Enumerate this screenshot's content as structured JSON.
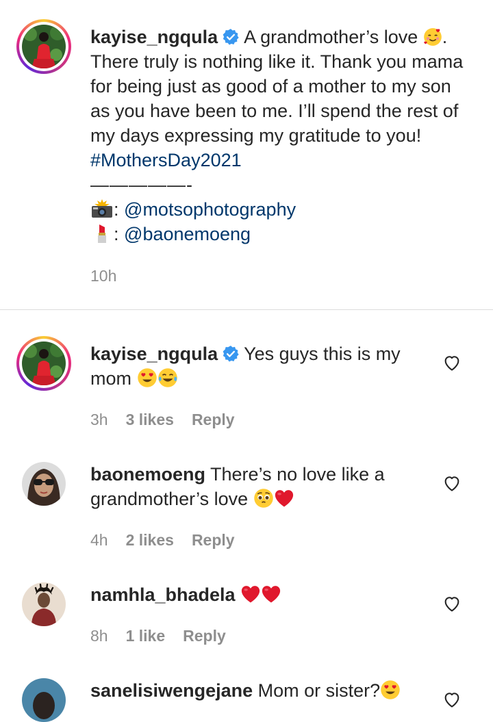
{
  "caption": {
    "username": "kayise_ngqula",
    "line1_text": "A grandmother’s love",
    "line1_end": ".",
    "body": "There truly is nothing like it. Thank you mama for being just as good of a mother to my son as you have been to me. I’ll spend the rest of my days expressing my gratitude to you!",
    "hashtag": "#MothersDay2021",
    "dashes": "—————-",
    "credit_photo_sep": ":",
    "credit_photo": "@motsophotography",
    "credit_makeup_sep": ":",
    "credit_makeup": "@baonemoeng",
    "time": "10h"
  },
  "comments": [
    {
      "username": "kayise_ngqula",
      "text": "Yes guys this is my mom",
      "time": "3h",
      "likes": "3 likes",
      "reply": "Reply"
    },
    {
      "username": "baonemoeng",
      "text": "There’s no love like a grandmother’s love",
      "time": "4h",
      "likes": "2 likes",
      "reply": "Reply"
    },
    {
      "username": "namhla_bhadela",
      "text": "",
      "time": "8h",
      "likes": "1 like",
      "reply": "Reply"
    },
    {
      "username": "sanelisiwengejane",
      "text": "Mom or sister?"
    }
  ],
  "colors": {
    "link": "#00376b",
    "meta": "#8e8e8e",
    "verified": "#3897f0",
    "heart": "#e0182d"
  },
  "icons": [
    "verified-badge-icon",
    "heart-outline-icon",
    "camera-flash-emoji",
    "lipstick-emoji",
    "smiling-hearts-emoji",
    "heart-eyes-emoji",
    "tears-of-joy-emoji",
    "pleading-face-emoji",
    "red-heart-emoji"
  ]
}
